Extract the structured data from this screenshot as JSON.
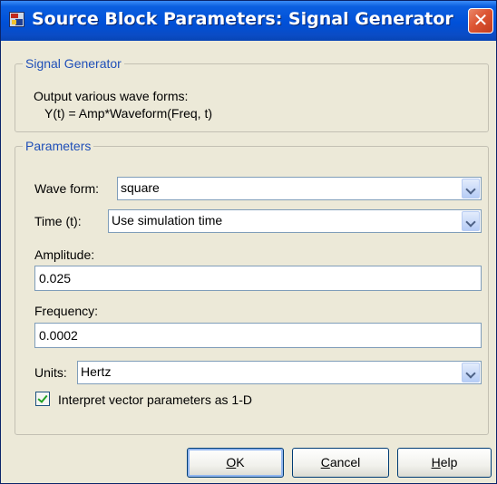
{
  "window": {
    "title": "Source Block Parameters: Signal Generator",
    "close_glyph": "✕",
    "icon": "simulink-block-icon"
  },
  "description": {
    "group_title": "Signal Generator",
    "line1": "Output various wave forms:",
    "line2": "Y(t) = Amp*Waveform(Freq, t)"
  },
  "parameters": {
    "group_title": "Parameters",
    "wave_form": {
      "label": "Wave form:",
      "value": "square"
    },
    "time": {
      "label": "Time (t):",
      "value": "Use simulation time"
    },
    "amplitude": {
      "label": "Amplitude:",
      "value": "0.025"
    },
    "frequency": {
      "label": "Frequency:",
      "value": "0.0002"
    },
    "units": {
      "label": "Units:",
      "value": "Hertz"
    },
    "interpret_vector": {
      "label": "Interpret vector parameters as 1-D",
      "checked": true
    }
  },
  "buttons": {
    "ok": "OK",
    "cancel": "Cancel",
    "help": "Help"
  },
  "colors": {
    "titlebar": "#0050d8",
    "close_button": "#dd5533",
    "group_legend": "#1f4fb8",
    "window_bg": "#ece9d8"
  }
}
